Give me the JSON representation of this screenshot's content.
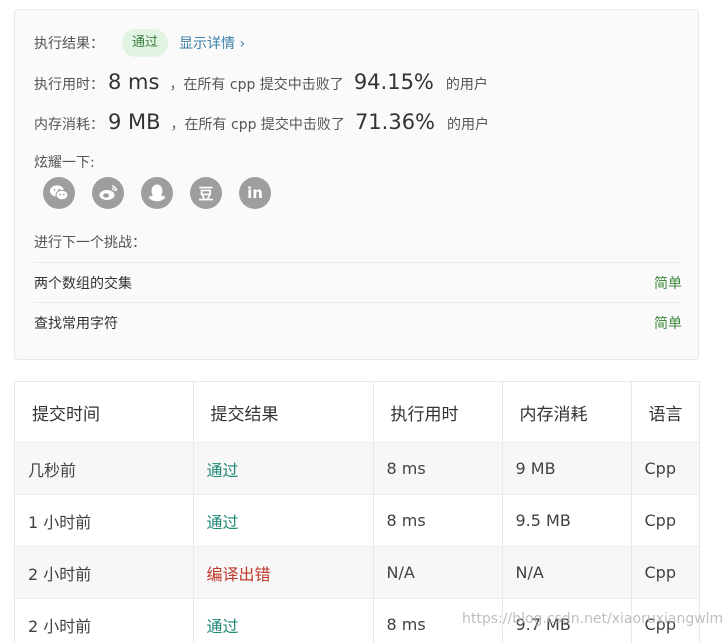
{
  "result": {
    "label": "执行结果：",
    "status": "通过",
    "detail_link": "显示详情 ›"
  },
  "runtime": {
    "label": "执行用时：",
    "value": "8 ms",
    "mid_text": "，在所有 cpp 提交中击败了",
    "percent": "94.15%",
    "tail": "的用户"
  },
  "memory": {
    "label": "内存消耗：",
    "value": "9 MB",
    "mid_text": "，在所有 cpp 提交中击败了",
    "percent": "71.36%",
    "tail": "的用户"
  },
  "share": {
    "label": "炫耀一下:",
    "icons": [
      "wechat-icon",
      "weibo-icon",
      "qq-icon",
      "douban-icon",
      "linkedin-icon"
    ],
    "douban_glyph": "豆",
    "linkedin_glyph": "in"
  },
  "next": {
    "label": "进行下一个挑战：",
    "challenges": [
      {
        "title": "两个数组的交集",
        "difficulty": "简单"
      },
      {
        "title": "查找常用字符",
        "difficulty": "简单"
      }
    ]
  },
  "submissions": {
    "headers": [
      "提交时间",
      "提交结果",
      "执行用时",
      "内存消耗",
      "语言"
    ],
    "rows": [
      {
        "time": "几秒前",
        "result": "通过",
        "runtime": "8 ms",
        "memory": "9 MB",
        "lang": "Cpp"
      },
      {
        "time": "1 小时前",
        "result": "通过",
        "runtime": "8 ms",
        "memory": "9.5 MB",
        "lang": "Cpp"
      },
      {
        "time": "2 小时前",
        "result": "编译出错",
        "runtime": "N/A",
        "memory": "N/A",
        "lang": "Cpp"
      },
      {
        "time": "2 小时前",
        "result": "通过",
        "runtime": "8 ms",
        "memory": "9.7 MB",
        "lang": "Cpp"
      }
    ]
  },
  "watermark": "https://blog.csdn.net/xiaoruxiangwlmx",
  "colors": {
    "pass": "#1e8a77",
    "fail": "#c0392b",
    "easy": "#3d8b3d",
    "icon_bg": "#9e9e9e"
  }
}
